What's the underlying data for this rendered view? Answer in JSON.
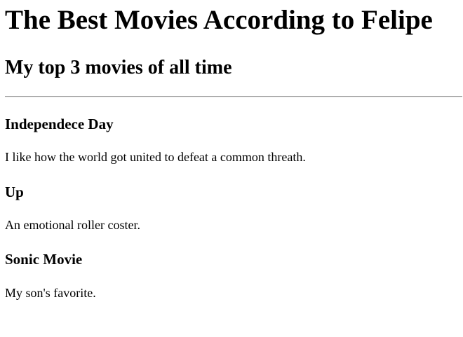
{
  "header": {
    "title": "The Best Movies According to Felipe",
    "subtitle": "My top 3 movies of all time"
  },
  "movies": [
    {
      "title": "Independece Day",
      "description": "I like how the world got united to defeat a common threath."
    },
    {
      "title": "Up",
      "description": "An emotional roller coster."
    },
    {
      "title": "Sonic Movie",
      "description": "My son's favorite."
    }
  ]
}
